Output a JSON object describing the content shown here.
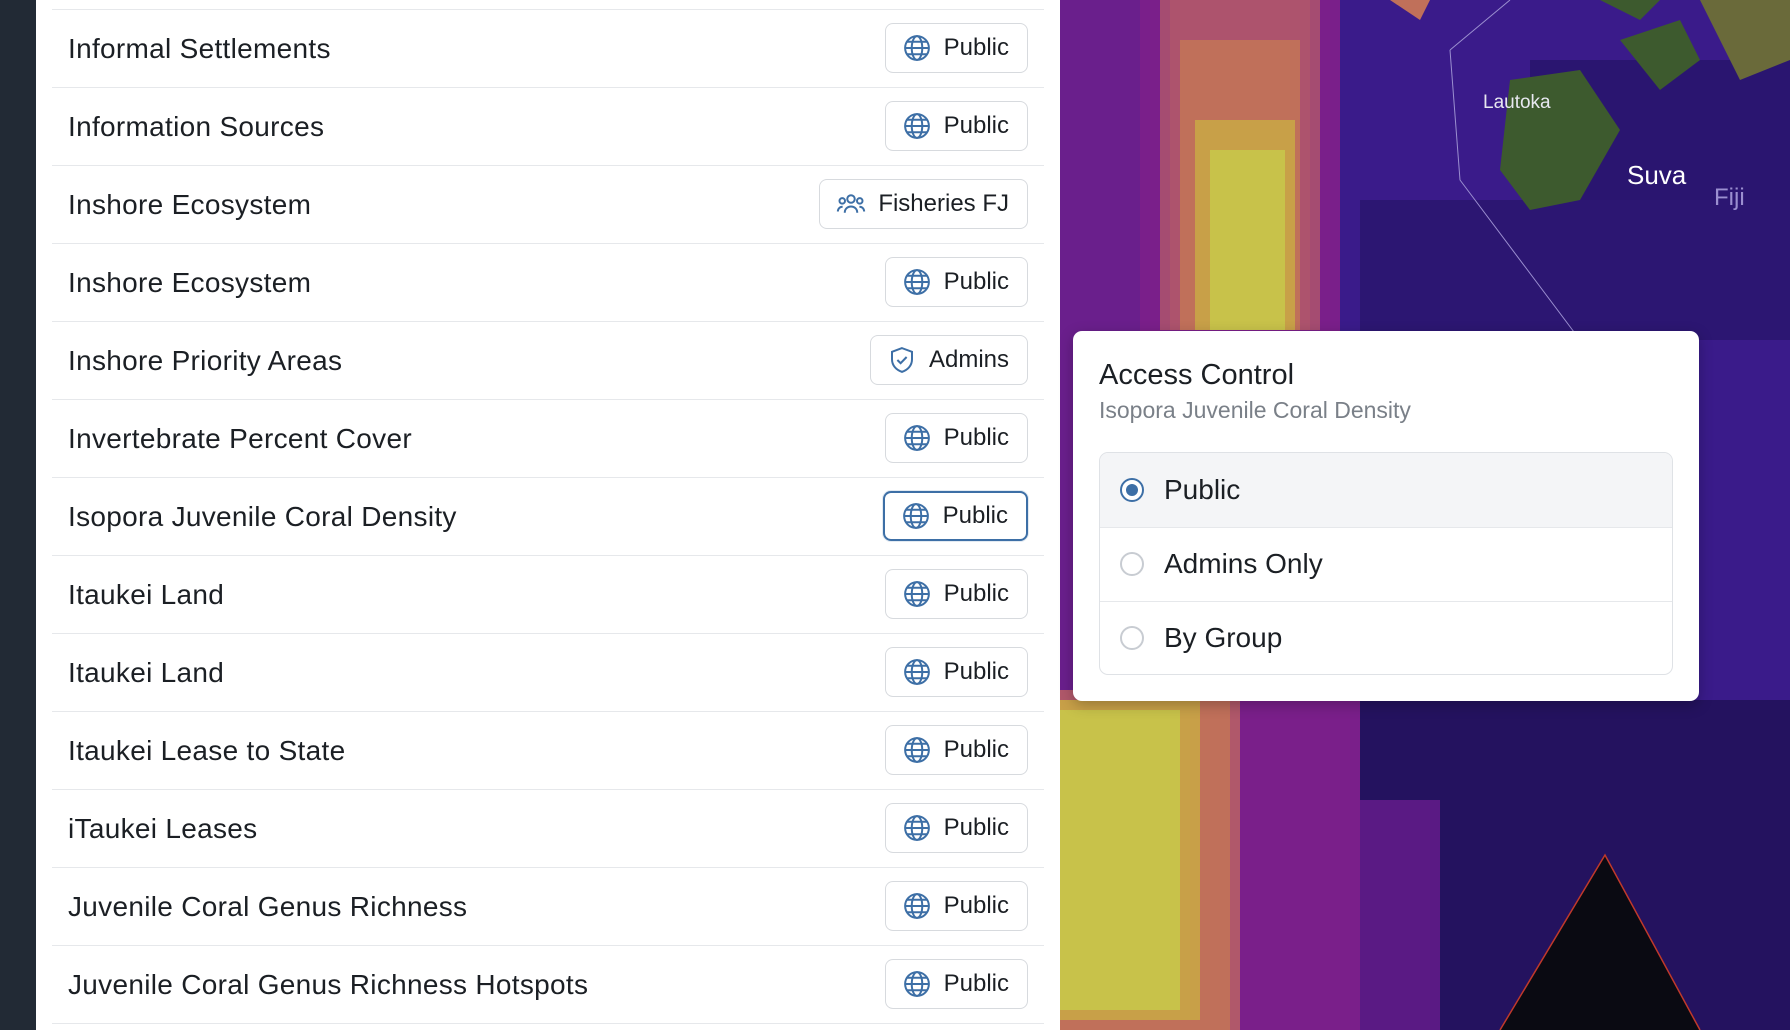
{
  "layers": [
    {
      "name": "Informal Settlements",
      "access": "Public",
      "icon": "globe-icon"
    },
    {
      "name": "Information Sources",
      "access": "Public",
      "icon": "globe-icon"
    },
    {
      "name": "Inshore Ecosystem",
      "access": "Fisheries FJ",
      "icon": "users-icon"
    },
    {
      "name": "Inshore Ecosystem",
      "access": "Public",
      "icon": "globe-icon"
    },
    {
      "name": "Inshore Priority Areas",
      "access": "Admins",
      "icon": "shield-icon"
    },
    {
      "name": "Invertebrate Percent Cover",
      "access": "Public",
      "icon": "globe-icon"
    },
    {
      "name": "Isopora Juvenile Coral Density",
      "access": "Public",
      "icon": "globe-icon",
      "selected": true
    },
    {
      "name": "Itaukei Land",
      "access": "Public",
      "icon": "globe-icon"
    },
    {
      "name": "Itaukei Land",
      "access": "Public",
      "icon": "globe-icon"
    },
    {
      "name": "Itaukei Lease to State",
      "access": "Public",
      "icon": "globe-icon"
    },
    {
      "name": "iTaukei Leases",
      "access": "Public",
      "icon": "globe-icon"
    },
    {
      "name": "Juvenile Coral Genus Richness",
      "access": "Public",
      "icon": "globe-icon"
    },
    {
      "name": "Juvenile Coral Genus Richness Hotspots",
      "access": "Public",
      "icon": "globe-icon"
    }
  ],
  "map": {
    "labels": {
      "lautoka": "Lautoka",
      "suva": "Suva",
      "fiji": "Fiji"
    }
  },
  "access_popup": {
    "title": "Access Control",
    "subtitle": "Isopora Juvenile Coral Density",
    "options": [
      {
        "label": "Public",
        "selected": true
      },
      {
        "label": "Admins Only",
        "selected": false
      },
      {
        "label": "By Group",
        "selected": false
      }
    ]
  },
  "colors": {
    "accent": "#3d6fa6",
    "map_deep": "#3a1b8a",
    "map_mid": "#7a1f8a",
    "map_warm": "#c0705a",
    "map_hot": "#c8c24a"
  }
}
